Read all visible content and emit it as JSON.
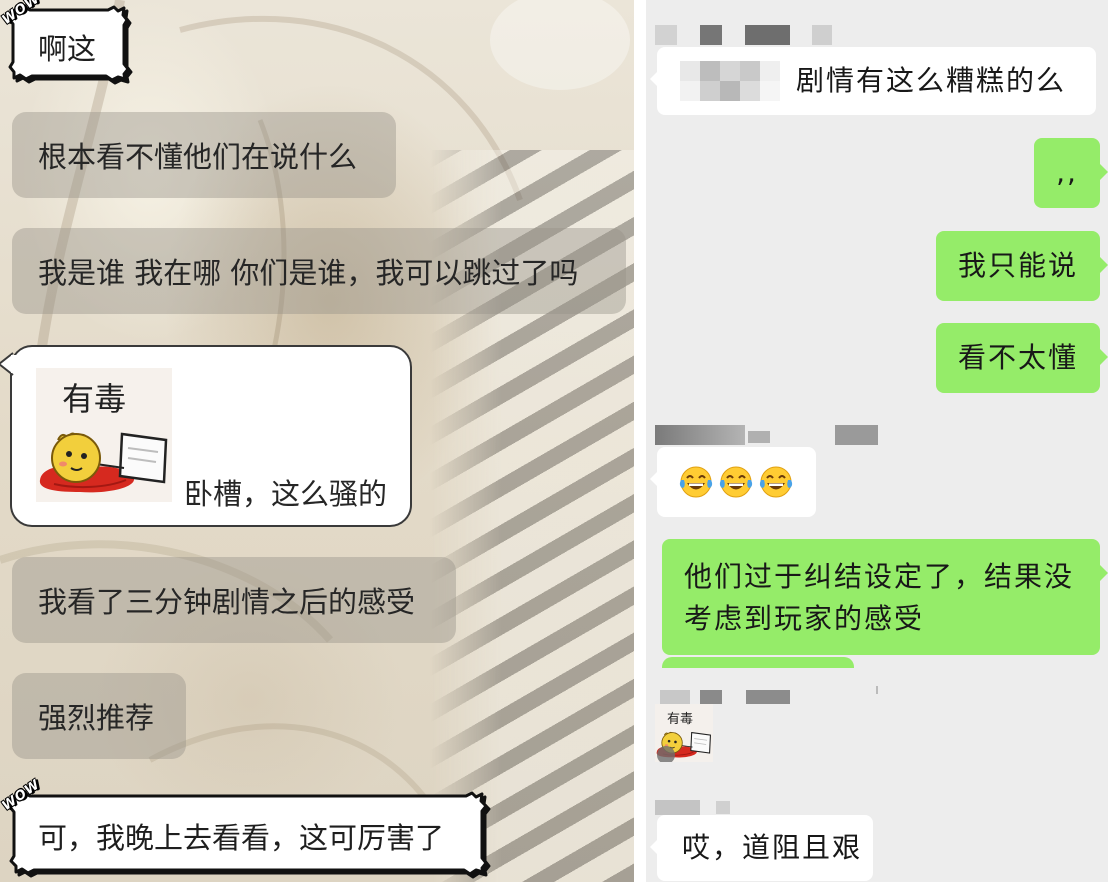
{
  "left_chat": {
    "comic_badge": "WOW",
    "messages": [
      {
        "text": "啊这"
      },
      {
        "text": "根本看不懂他们在说什么"
      },
      {
        "text": "我是谁 我在哪 你们是谁，我可以跳过了吗"
      },
      {
        "sticker_caption": "有毒",
        "text": "卧槽，这么骚的"
      },
      {
        "text": "我看了三分钟剧情之后的感受"
      },
      {
        "text": "强烈推荐"
      },
      {
        "text": "可，我晚上去看看，这可厉害了"
      }
    ]
  },
  "right_chat": {
    "colors": {
      "background": "#ededed",
      "received_bubble": "#ffffff",
      "sent_bubble": "#95ec69"
    },
    "messages": [
      {
        "sent": false,
        "text": "剧情有这么糟糕的么"
      },
      {
        "sent": true,
        "text": ",,"
      },
      {
        "sent": true,
        "text": "我只能说"
      },
      {
        "sent": true,
        "text": "看不太懂"
      },
      {
        "sent": false,
        "emoji": [
          "face-with-tears-of-joy",
          "face-with-tears-of-joy",
          "face-with-tears-of-joy"
        ]
      },
      {
        "sent": true,
        "lines": [
          "他们过于纠结设定了，结果没",
          "考虑到玩家的感受"
        ]
      },
      {
        "sent": false,
        "sticker_caption": "有毒"
      },
      {
        "sent": false,
        "text": "哎，道阻且艰"
      }
    ]
  }
}
